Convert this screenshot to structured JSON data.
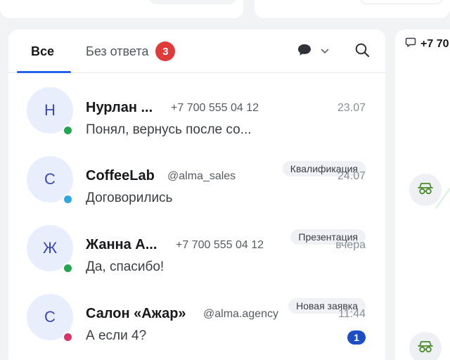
{
  "tabs": {
    "all_label": "Все",
    "unanswered_label": "Без ответа",
    "unanswered_count": "3"
  },
  "icons": {
    "filter": "chat-bubble-icon",
    "dropdown": "chevron-down-icon",
    "search": "search-icon",
    "bot": "bot-glasses-icon"
  },
  "colors": {
    "accent": "#2563eb",
    "badge_red": "#e03a3a",
    "status_green": "#1fa84f",
    "status_blue": "#2da8e6",
    "status_pink": "#d8346a",
    "count_badge": "#1d4fc4"
  },
  "conversations": [
    {
      "initial": "Н",
      "name": "Нурлан ...",
      "contact": "+7 700 555 04 12",
      "time": "23.07",
      "preview": "Понял, вернусь после со...",
      "tag": "Квалификация",
      "status_color": "#1fa84f"
    },
    {
      "initial": "С",
      "name": "CoffeeLab",
      "contact": "@alma_sales",
      "time": "24.07",
      "preview": "Договорились",
      "tag": "Презентация",
      "status_color": "#2da8e6"
    },
    {
      "initial": "Ж",
      "name": "Жанна А...",
      "contact": "+7 700 555 04 12",
      "time": "вчера",
      "preview": "Да, спасибо!",
      "tag": "Новая заявка",
      "status_color": "#1fa84f"
    },
    {
      "initial": "С",
      "name": "Салон «Ажар»",
      "contact": "@alma.agency",
      "time": "11:44",
      "preview": "А если 4?",
      "unread": "1",
      "status_color": "#d8346a"
    }
  ],
  "right_panel": {
    "phone": "+7 70"
  }
}
